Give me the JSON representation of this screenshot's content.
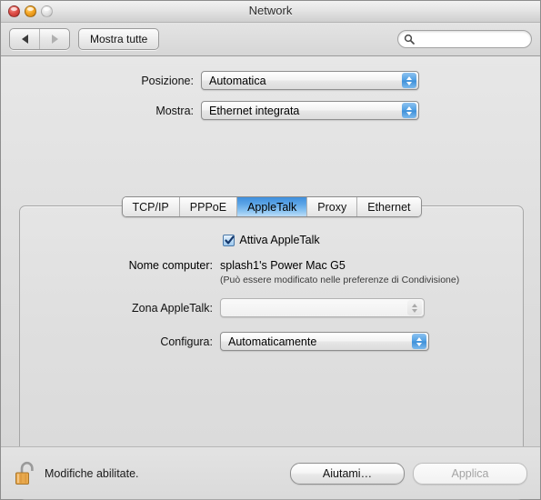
{
  "window": {
    "title": "Network",
    "traffic_lights": [
      {
        "name": "close",
        "label": "Chiudi"
      },
      {
        "name": "minimize",
        "label": "Riduci a icona"
      },
      {
        "name": "zoom",
        "label": "Ingrandisci"
      }
    ]
  },
  "toolbar": {
    "back_icon": "triangle-left-icon",
    "forward_icon": "triangle-right-icon",
    "show_all_label": "Mostra tutte",
    "search": {
      "icon": "search-icon",
      "value": "",
      "placeholder": ""
    }
  },
  "form": {
    "location": {
      "label": "Posizione:",
      "value": "Automatica",
      "enabled": true
    },
    "show": {
      "label": "Mostra:",
      "value": "Ethernet integrata",
      "enabled": true
    }
  },
  "tabs": [
    {
      "label": "TCP/IP",
      "selected": false
    },
    {
      "label": "PPPoE",
      "selected": false
    },
    {
      "label": "AppleTalk",
      "selected": true
    },
    {
      "label": "Proxy",
      "selected": false
    },
    {
      "label": "Ethernet",
      "selected": false
    }
  ],
  "panel": {
    "enable_appletalk": {
      "label": "Attiva AppleTalk",
      "checked": true,
      "icon": "checkmark-icon"
    },
    "computer_name": {
      "label": "Nome computer:",
      "value": "splash1's Power Mac G5",
      "hint": "(Può essere modificato nelle preferenze di Condivisione)"
    },
    "appletalk_zone": {
      "label": "Zona AppleTalk:",
      "value": "",
      "enabled": false
    },
    "configure": {
      "label": "Configura:",
      "value": "Automaticamente",
      "enabled": true
    },
    "help_button": {
      "label": "?",
      "icon": "question-mark-icon"
    }
  },
  "bottom": {
    "lock_icon": "unlocked-padlock-icon",
    "lock_status": "Modifiche abilitate.",
    "help_label": "Aiutami…",
    "apply_label": "Applica",
    "apply_enabled": false
  },
  "colors": {
    "accent_blue": "#3d8fd8",
    "tab_selected_top": "#3e8fdd",
    "checkbox_blue": "#4a78a8",
    "help_purple": "#b3a8c9",
    "lock_gold": "#e8a84c"
  }
}
